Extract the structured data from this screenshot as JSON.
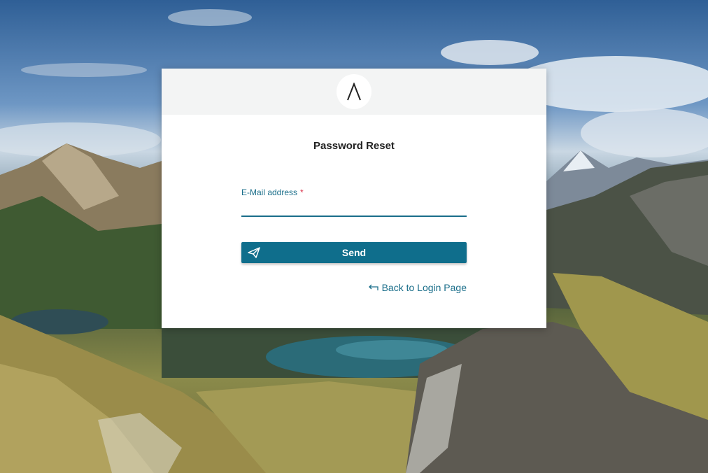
{
  "card": {
    "title": "Password Reset"
  },
  "form": {
    "email_label": "E-Mail address",
    "email_required_marker": "*",
    "email_value": "",
    "email_placeholder": ""
  },
  "actions": {
    "send_label": "Send",
    "back_label": "Back to Login Page"
  },
  "icons": {
    "logo": "lambda-logo-icon",
    "send": "paper-plane-icon",
    "back": "return-arrow-icon"
  },
  "colors": {
    "accent": "#0f6e8c",
    "link": "#1a6e8a",
    "required": "#d9334a",
    "header_bg": "#f3f4f4"
  }
}
